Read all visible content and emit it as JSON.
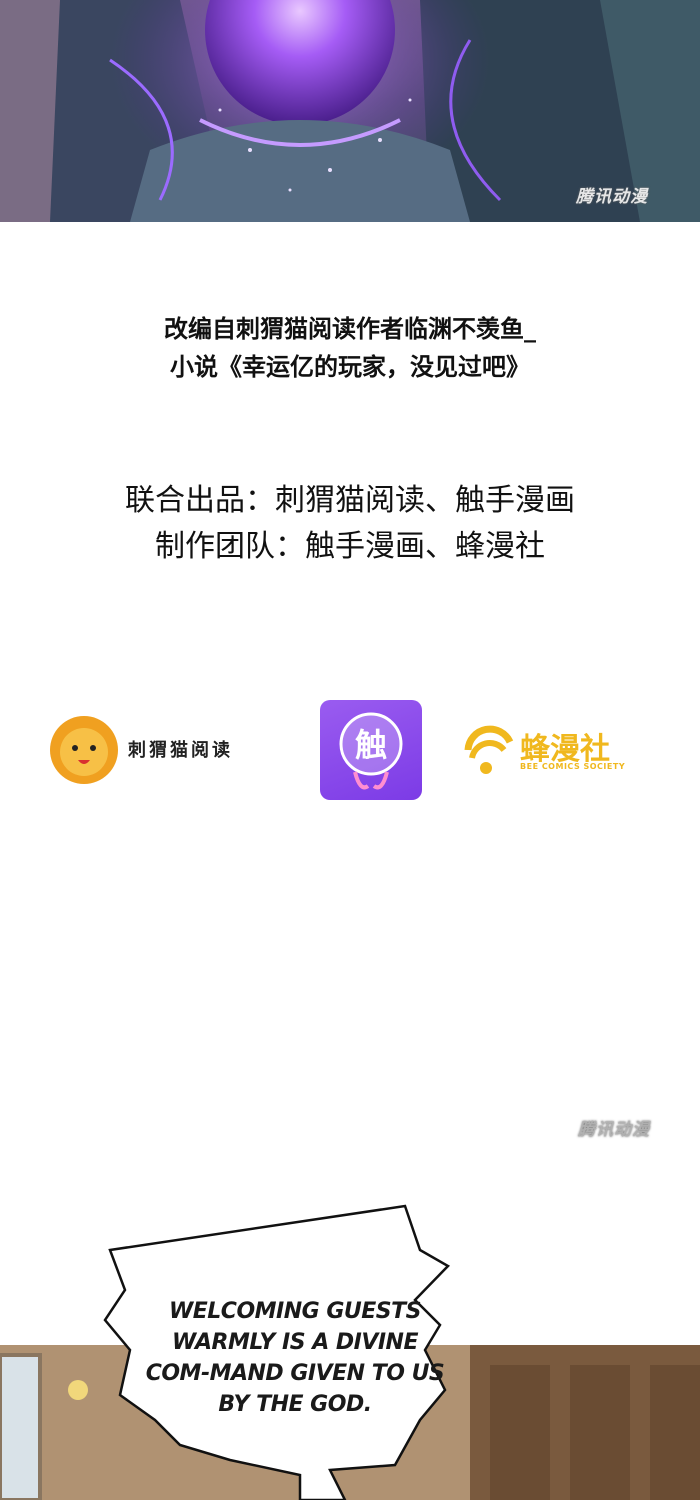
{
  "credits": {
    "adapted_line1": "改编自刺猬猫阅读作者临渊不羡鱼_",
    "adapted_line2": "小说《幸运亿的玩家，没见过吧》",
    "joint_production": "联合出品：刺猬猫阅读、触手漫画",
    "production_team": "制作团队：触手漫画、蜂漫社"
  },
  "logos": {
    "cat_logo_name": "刺猬猫阅读",
    "touch_logo_char": "触",
    "bee_logo_name": "蜂漫社",
    "bee_logo_sub": "BEE COMICS SOCIETY"
  },
  "watermarks": {
    "top": "腾讯动漫",
    "middle": "腾讯动漫"
  },
  "speech_bubble": {
    "text": "WELCOMING GUESTS WARMLY IS A DIVINE COM-MAND GIVEN TO US BY THE GOD."
  },
  "colors": {
    "touch_logo": "#8a4ae8",
    "bee_logo": "#f0b81e",
    "cat_logo": "#f0a020"
  }
}
